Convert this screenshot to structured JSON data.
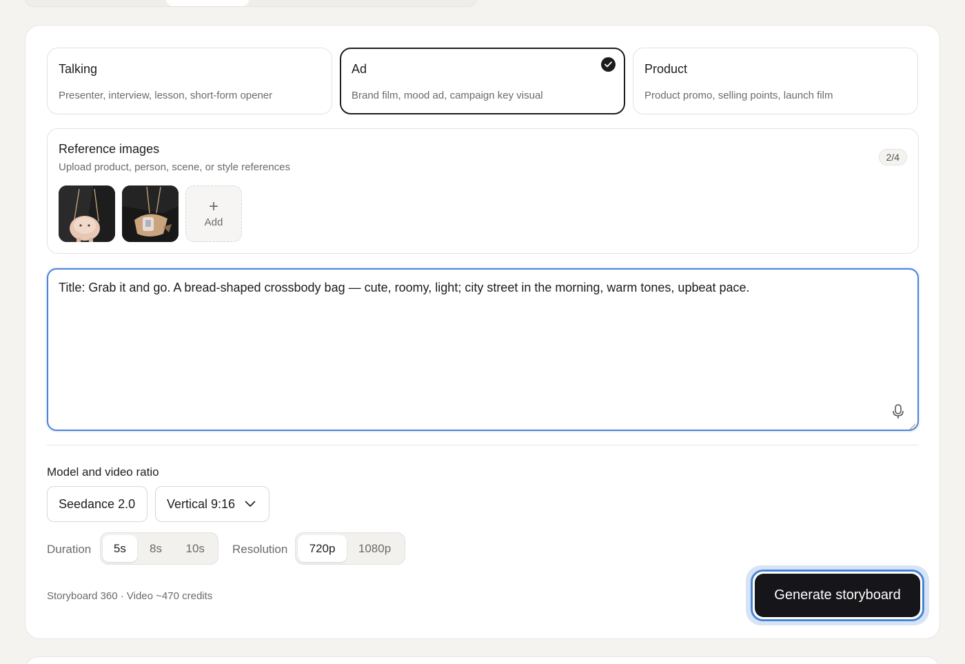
{
  "modes": [
    {
      "title": "Talking",
      "desc": "Presenter, interview, lesson, short-form opener",
      "selected": false
    },
    {
      "title": "Ad",
      "desc": "Brand film, mood ad, campaign key visual",
      "selected": true
    },
    {
      "title": "Product",
      "desc": "Product promo, selling points, launch film",
      "selected": false
    }
  ],
  "reference": {
    "title": "Reference images",
    "subtitle": "Upload product, person, scene, or style references",
    "count": "2/4",
    "add_label": "Add"
  },
  "prompt": {
    "value": "Title: Grab it and go. A bread-shaped crossbody bag — cute, roomy, light; city street in the morning, warm tones, upbeat pace."
  },
  "settings": {
    "section_label": "Model and video ratio",
    "model": "Seedance 2.0",
    "ratio": "Vertical 9:16",
    "duration_label": "Duration",
    "durations": [
      "5s",
      "8s",
      "10s"
    ],
    "duration_selected": "5s",
    "resolution_label": "Resolution",
    "resolutions": [
      "720p",
      "1080p"
    ],
    "resolution_selected": "720p"
  },
  "footer": {
    "credits": "Storyboard 360 · Video ~470 credits",
    "generate_label": "Generate storyboard"
  },
  "colors": {
    "accent": "#4a84d6",
    "primary_dark": "#16161a"
  }
}
